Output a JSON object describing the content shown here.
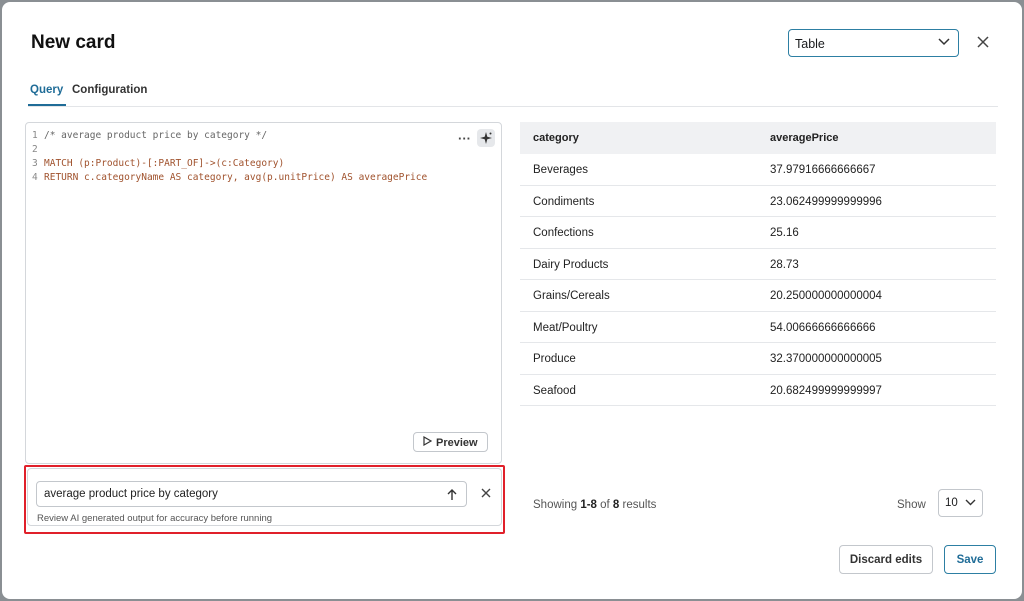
{
  "modal": {
    "title": "New card",
    "visualization_select": "Table",
    "tabs": [
      "Query",
      "Configuration"
    ]
  },
  "editor": {
    "lines": [
      {
        "n": "1",
        "text": "/* average product price by category */"
      },
      {
        "n": "2",
        "text": ""
      },
      {
        "n": "3",
        "text": "MATCH (p:Product)-[:PART_OF]->(c:Category)"
      },
      {
        "n": "4",
        "text": "RETURN c.categoryName AS category, avg(p.unitPrice) AS averagePrice"
      }
    ],
    "more_label": "···",
    "preview_label": "Preview"
  },
  "ai_prompt": {
    "value": "average product price by category",
    "hint": "Review AI generated output for accuracy before running"
  },
  "results": {
    "columns": [
      "category",
      "averagePrice"
    ],
    "rows": [
      [
        "Beverages",
        "37.97916666666667"
      ],
      [
        "Condiments",
        "23.062499999999996"
      ],
      [
        "Confections",
        "25.16"
      ],
      [
        "Dairy Products",
        "28.73"
      ],
      [
        "Grains/Cereals",
        "20.250000000000004"
      ],
      [
        "Meat/Poultry",
        "54.00666666666666"
      ],
      [
        "Produce",
        "32.370000000000005"
      ],
      [
        "Seafood",
        "20.682499999999997"
      ]
    ]
  },
  "pagination": {
    "showing_prefix": "Showing ",
    "range": "1-8",
    "of": " of ",
    "total": "8",
    "suffix": " results",
    "show_label": "Show",
    "page_size": "10"
  },
  "footer": {
    "discard_label": "Discard edits",
    "save_label": "Save"
  },
  "colors": {
    "accent": "#1f6c97",
    "highlight": "#e0202a"
  }
}
